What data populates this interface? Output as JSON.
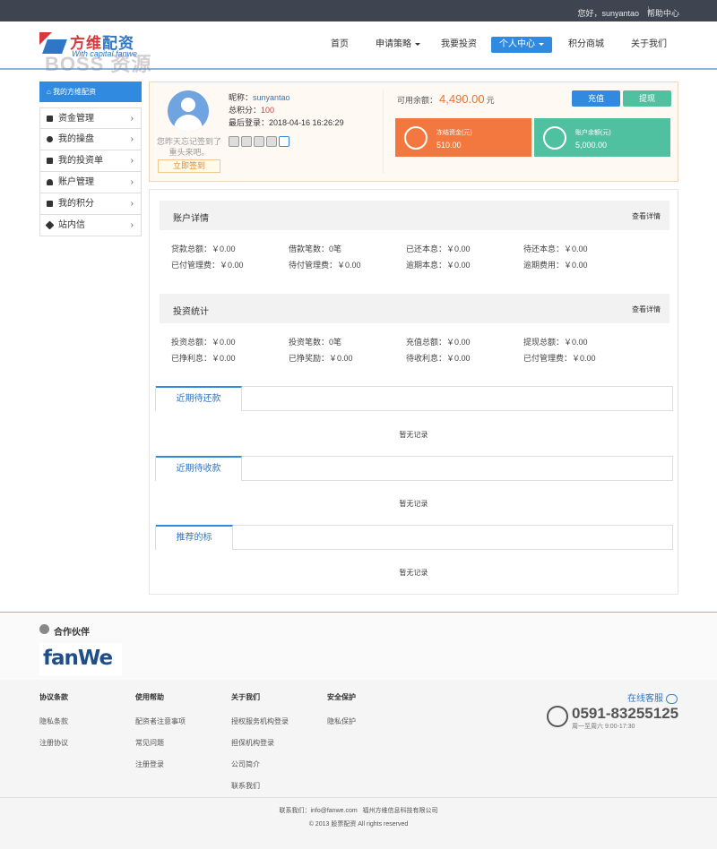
{
  "topbar": {
    "greeting": "您好，sunyantao",
    "help": "帮助中心"
  },
  "logo": {
    "cn_a": "方维",
    "cn_b": "配资",
    "en": "With capital fanwe",
    "watermark": "BOSS 资源"
  },
  "nav": {
    "items": [
      "首页",
      "申请策略",
      "我要投资",
      "个人中心",
      "积分商城",
      "关于我们"
    ]
  },
  "sidebar": {
    "header": "我的方维配资",
    "items": [
      "资金管理",
      "我的操盘",
      "我的投资单",
      "账户管理",
      "我的积分",
      "站内信"
    ]
  },
  "profile": {
    "nickname_label": "昵称：",
    "nickname": "sunyantao",
    "points_label": "总积分：",
    "points": "100",
    "last_login": "最后登录：2018-04-16 16:26:29",
    "sign_tip": "您昨天忘记签到了重头来吧。",
    "sign_button": "立即签到",
    "balance_label": "可用余额：",
    "balance": "4,490.00",
    "balance_unit": "元",
    "recharge": "充值",
    "withdraw": "提现",
    "frozen_label": "冻结资金(元)",
    "frozen": "510.00",
    "account_label": "账户余额(元)",
    "account": "5,000.00"
  },
  "account_detail": {
    "title": "账户详情",
    "more": "查看详情",
    "row1": [
      "贷款总额：￥0.00",
      "借款笔数：0笔",
      "已还本息：￥0.00",
      "待还本息：￥0.00"
    ],
    "row2": [
      "已付管理费：￥0.00",
      "待付管理费：￥0.00",
      "逾期本息：￥0.00",
      "逾期费用：￥0.00"
    ]
  },
  "invest_stats": {
    "title": "投资统计",
    "more": "查看详情",
    "row1": [
      "投资总额：￥0.00",
      "投资笔数：0笔",
      "充值总额：￥0.00",
      "提现总额：￥0.00"
    ],
    "row2": [
      "已挣利息：￥0.00",
      "已挣奖励：￥0.00",
      "待收利息：￥0.00",
      "已付管理费：￥0.00"
    ]
  },
  "tabs": [
    {
      "label": "近期待还款",
      "empty": "暂无记录"
    },
    {
      "label": "近期待收款",
      "empty": "暂无记录"
    },
    {
      "label": "推荐的标",
      "empty": "暂无记录"
    }
  ],
  "partner": {
    "title": "合作伙伴",
    "logo_text": "fanWe"
  },
  "footer": {
    "cols": [
      {
        "title": "协议条款",
        "links": [
          "隐私条款",
          "注册协议"
        ]
      },
      {
        "title": "使用帮助",
        "links": [
          "配资者注意事项",
          "常见问题",
          "注册登录"
        ]
      },
      {
        "title": "关于我们",
        "links": [
          "授权服务机构登录",
          "担保机构登录",
          "公司简介",
          "联系我们"
        ]
      },
      {
        "title": "安全保护",
        "links": [
          "隐私保护"
        ]
      }
    ],
    "kefu": "在线客服",
    "phone": "0591-83255125",
    "hours": "周一至周六 9:00-17:30",
    "contact": "联系我们：info@fanwe.com",
    "company": "福州方维信息科技有限公司",
    "copyright": "© 2013 股票配资 All rights reserved"
  },
  "colors": {
    "brand_blue": "#2f8ae0",
    "brand_red": "#d8383a",
    "orange": "#f3783f",
    "teal": "#4fc1a1"
  }
}
